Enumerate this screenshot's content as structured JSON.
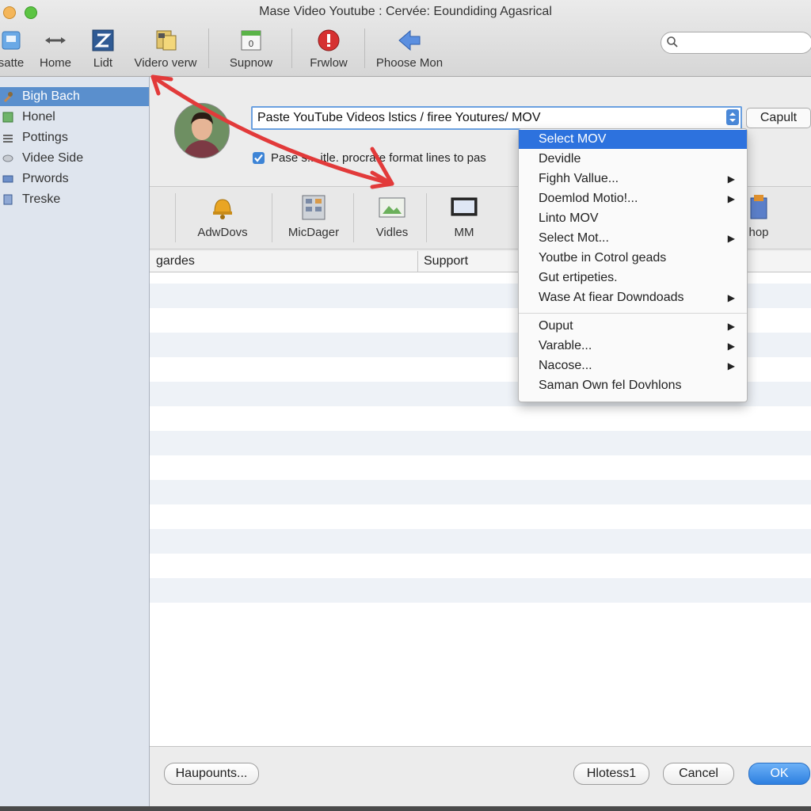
{
  "window": {
    "title": "Mase Video Youtube : Cervée: Eoundiding Agasrical"
  },
  "toolbar": {
    "items": [
      {
        "label": "satte"
      },
      {
        "label": "Home"
      },
      {
        "label": "Lidt"
      },
      {
        "label": "Videro verw"
      },
      {
        "label": "Supnow"
      },
      {
        "label": "Frwlow"
      },
      {
        "label": "Phoose Mon"
      }
    ],
    "search_placeholder": ""
  },
  "sidebar": {
    "items": [
      {
        "label": "Bigh Bach",
        "selected": true
      },
      {
        "label": "Honel"
      },
      {
        "label": "Pottings"
      },
      {
        "label": "Videe Side"
      },
      {
        "label": "Prwords"
      },
      {
        "label": "Treske"
      }
    ]
  },
  "main": {
    "url_value": "Paste YouTube Videos lstics / firee Youtures/ MOV",
    "capture_label": "Capult",
    "checkbox_label": "Pase s... itle. procrate format lines to pas",
    "checkbox_checked": true,
    "icon_strip": [
      {
        "label": "AdwDovs"
      },
      {
        "label": "MicDager"
      },
      {
        "label": "Vidles"
      },
      {
        "label": "MM"
      },
      {
        "label": "hop"
      }
    ],
    "table": {
      "columns": [
        "gardes",
        "Support"
      ]
    }
  },
  "menu": {
    "items": [
      {
        "label": "Select MOV",
        "selected": true,
        "submenu": false
      },
      {
        "label": "Devidle",
        "submenu": false
      },
      {
        "label": "Fighh Vallue...",
        "submenu": true
      },
      {
        "label": "Doemlod Motio!...",
        "submenu": true
      },
      {
        "label": "Linto MOV",
        "submenu": false
      },
      {
        "label": "Select Mot...",
        "submenu": true
      },
      {
        "label": "Youtbe in Cotrol geads",
        "submenu": false
      },
      {
        "label": "Gut ertipeties.",
        "submenu": false
      },
      {
        "label": "Wase At fiear Downdoads",
        "submenu": true
      },
      {
        "label": "Ouput",
        "submenu": true
      },
      {
        "label": "Varable...",
        "submenu": true
      },
      {
        "label": "Nacose...",
        "submenu": true
      },
      {
        "label": "Saman Own fel Dovhlons",
        "submenu": false
      }
    ]
  },
  "footer": {
    "left_button": "Haupounts...",
    "hotkeys_button": "Hlotess1",
    "cancel_button": "Cancel",
    "ok_button": "OK"
  },
  "colors": {
    "selection_blue": "#2d72de",
    "sidebar_selection": "#5a8fcd",
    "arrow_red": "#e23a3a",
    "ok_blue": "#2d7fe0"
  }
}
